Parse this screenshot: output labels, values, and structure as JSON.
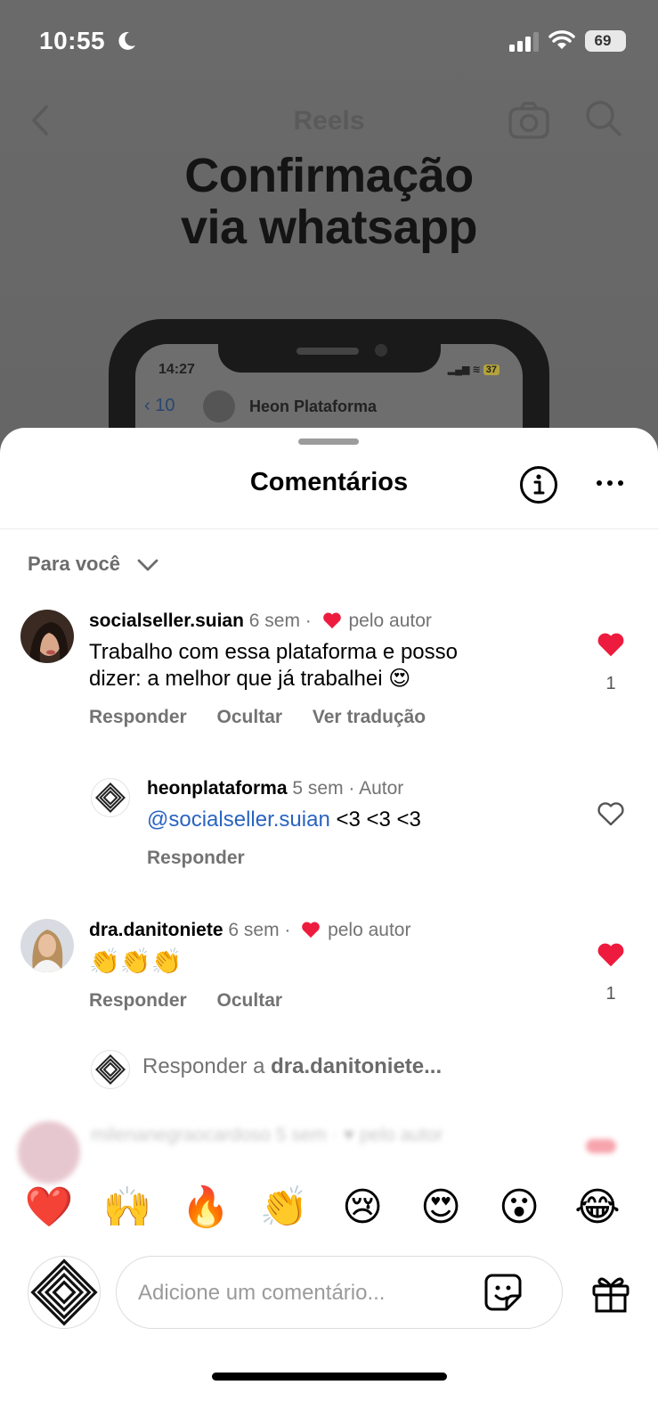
{
  "status_bar": {
    "time": "10:55",
    "battery": "69"
  },
  "reel": {
    "header_title": "Reels",
    "headline_line1": "Confirmação",
    "headline_line2": "via whatsapp",
    "phone_time": "14:27",
    "phone_battery": "37",
    "chat_back_count": "10",
    "chat_name": "Heon Plataforma"
  },
  "sheet": {
    "title": "Comentários",
    "filter_label": "Para você"
  },
  "comments": [
    {
      "username": "socialseller.suian",
      "time": "6 sem",
      "liked_by_author_label": "pelo autor",
      "text": "Trabalho com essa plataforma e posso dizer: a melhor que já trabalhei 😍",
      "actions": [
        "Responder",
        "Ocultar",
        "Ver tradução"
      ],
      "like_count": "1",
      "liked": true
    },
    {
      "username": "heonplataforma",
      "time": "5 sem",
      "badge": "Autor",
      "mention": "@socialseller.suian",
      "text": "<3 <3 <3",
      "actions": [
        "Responder"
      ],
      "liked": false
    },
    {
      "username": "dra.danitoniete",
      "time": "6 sem",
      "liked_by_author_label": "pelo autor",
      "text": "👏👏👏",
      "actions": [
        "Responder",
        "Ocultar"
      ],
      "like_count": "1",
      "liked": true
    }
  ],
  "reply_prompt": {
    "prefix": "Responder a",
    "target": "dra.danitoniete..."
  },
  "blurred_comment": {
    "username": "milenanegraocardoso",
    "time": "5 sem",
    "liked_by_author_label": "pelo autor"
  },
  "emoji_bar": [
    "❤️",
    "🙌",
    "🔥",
    "👏",
    "😢",
    "😍",
    "😮",
    "😂"
  ],
  "composer": {
    "placeholder": "Adicione um comentário..."
  },
  "colors": {
    "heart": "#ed1c3e",
    "link": "#2a64c0",
    "muted": "#737373"
  }
}
